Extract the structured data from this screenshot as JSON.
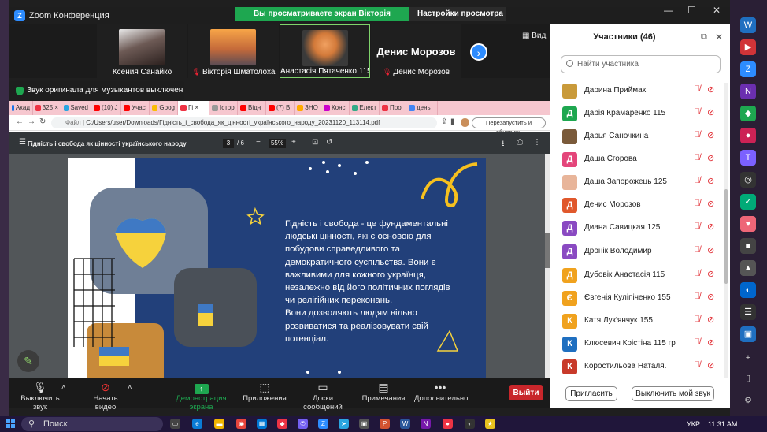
{
  "window": {
    "title": "Zoom Конференция",
    "share_banner": "Вы просматриваете экран Вікторія Шматолоха",
    "view_settings": "Настройки просмотра",
    "view_label": "Вид"
  },
  "tiles": [
    {
      "name": "Ксения Санайко",
      "muted": false
    },
    {
      "name": "Вікторія Шматолоха",
      "muted": true
    },
    {
      "name": "Анастасія Пятаченко 115",
      "muted": false
    },
    {
      "name": "Денис Морозов",
      "muted": true,
      "big_name": "Денис Морозов"
    }
  ],
  "notification": "Звук оригинала для музыкантов выключен",
  "browser": {
    "tabs": [
      "Акад",
      "325 ×",
      "Saved",
      "(10) J",
      "Учас",
      "Goog",
      "Гі ×",
      "Істор",
      "Відн",
      "(7) В",
      "ЗНО",
      "Конс",
      "Елект",
      "Про",
      "день"
    ],
    "url_scheme": "Файл",
    "url": "C:/Users/user/Downloads/Гідність_і_свобода_як_цінності_українського_народу_20231120_113114.pdf",
    "restart_button": "Перезапустить и обновить"
  },
  "pdf": {
    "title": "Гідність і свобода як цінності українського народу",
    "page": "3",
    "page_count": "/ 6",
    "zoom": "55%"
  },
  "slide": {
    "lines": [
      "Гідність і свобода - це фундаментальні",
      "людські цінності, які є основою для",
      "побудови справедливого та",
      "демократичного суспільства. Вони є",
      "важливими для кожного українця,",
      "незалежно від його політичних поглядів",
      "чи релігійних переконань.",
      "Вони дозволяють людям вільно",
      "розвиватися та реалізовувати свій",
      "потенціал."
    ]
  },
  "toolbar": {
    "mute": "Выключить звук",
    "video": "Начать видео",
    "share": "Демонстрация экрана",
    "apps": "Приложения",
    "whiteboard": "Доски сообщений",
    "notes": "Примечания",
    "more": "Дополнительно",
    "leave": "Выйти"
  },
  "participants": {
    "title": "Участники (46)",
    "search_placeholder": "Найти участника",
    "invite": "Пригласить",
    "mute_me": "Выключить мой звук",
    "list": [
      {
        "initial": "",
        "name": "Дарина Приймак",
        "color": "#c99a3a"
      },
      {
        "initial": "Д",
        "name": "Дарія Крамаренко 115",
        "color": "#1ea750"
      },
      {
        "initial": "",
        "name": "Дарья Саночкина",
        "color": "#7a5a3a"
      },
      {
        "initial": "Д",
        "name": "Даша Єгорова",
        "color": "#e4457a"
      },
      {
        "initial": "",
        "name": "Даша Запорожець 125",
        "color": "#e8b59a"
      },
      {
        "initial": "Д",
        "name": "Денис Морозов",
        "color": "#e0582c"
      },
      {
        "initial": "Д",
        "name": "Диана Савицкая 125",
        "color": "#8a4ac2"
      },
      {
        "initial": "Д",
        "name": "Дронік Володимир",
        "color": "#8a4ac2"
      },
      {
        "initial": "Д",
        "name": "Дубовік Анастасія 115",
        "color": "#f0a21e"
      },
      {
        "initial": "Є",
        "name": "Євгенія Куліпіченко 155",
        "color": "#f0a21e"
      },
      {
        "initial": "К",
        "name": "Катя Лук'янчук 155",
        "color": "#f0a21e"
      },
      {
        "initial": "К",
        "name": "Клюсевич Крістіна 115 гр",
        "color": "#1f6fc0"
      },
      {
        "initial": "К",
        "name": "Коростильова Наталя.",
        "color": "#c83a2a"
      }
    ]
  },
  "taskbar": {
    "search": "Поиск",
    "lang": "УКР",
    "time": "11:31 AM"
  }
}
